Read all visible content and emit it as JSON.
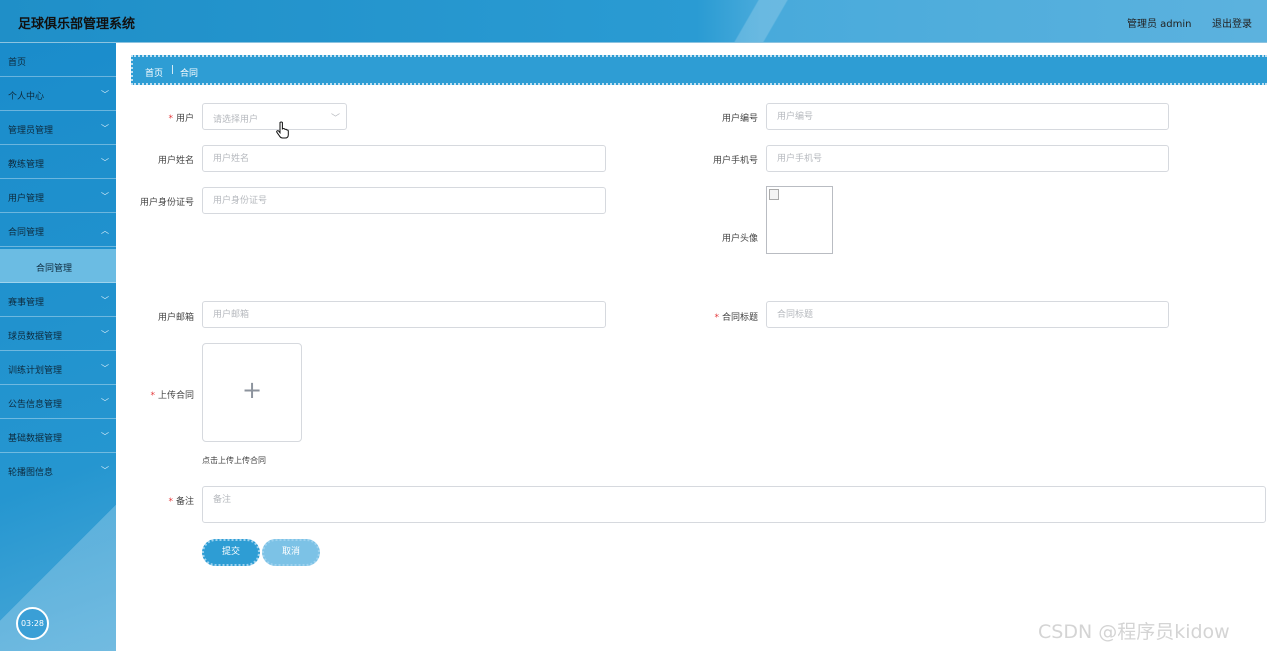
{
  "header": {
    "title": "足球俱乐部管理系统",
    "admin": "管理员 admin",
    "logout": "退出登录"
  },
  "sidebar": {
    "items": [
      {
        "label": "首页",
        "expandable": false
      },
      {
        "label": "个人中心",
        "expandable": true
      },
      {
        "label": "管理员管理",
        "expandable": true
      },
      {
        "label": "教练管理",
        "expandable": true
      },
      {
        "label": "用户管理",
        "expandable": true
      },
      {
        "label": "合同管理",
        "expandable": true
      },
      {
        "label": "赛事管理",
        "expandable": true
      },
      {
        "label": "球员数据管理",
        "expandable": true
      },
      {
        "label": "训练计划管理",
        "expandable": true
      },
      {
        "label": "公告信息管理",
        "expandable": true
      },
      {
        "label": "基础数据管理",
        "expandable": true
      },
      {
        "label": "轮播图信息",
        "expandable": true
      }
    ],
    "submenu": {
      "label": "合同管理"
    },
    "clock": "03:28"
  },
  "breadcrumb": {
    "home": "首页",
    "current": "合同"
  },
  "form": {
    "user_label": "用户",
    "user_placeholder": "请选择用户",
    "user_no_label": "用户编号",
    "user_no_placeholder": "用户编号",
    "user_name_label": "用户姓名",
    "user_name_placeholder": "用户姓名",
    "user_phone_label": "用户手机号",
    "user_phone_placeholder": "用户手机号",
    "user_id_label": "用户身份证号",
    "user_id_placeholder": "用户身份证号",
    "user_avatar_label": "用户头像",
    "user_email_label": "用户邮箱",
    "user_email_placeholder": "用户邮箱",
    "contract_title_label": "合同标题",
    "contract_title_placeholder": "合同标题",
    "upload_label": "上传合同",
    "upload_tip": "点击上传上传合同",
    "remark_label": "备注",
    "remark_placeholder": "备注",
    "submit": "提交",
    "cancel": "取消"
  },
  "watermark": "CSDN @程序员kidow",
  "colors": {
    "primary": "#2e9dd4",
    "required": "#e4393c"
  }
}
